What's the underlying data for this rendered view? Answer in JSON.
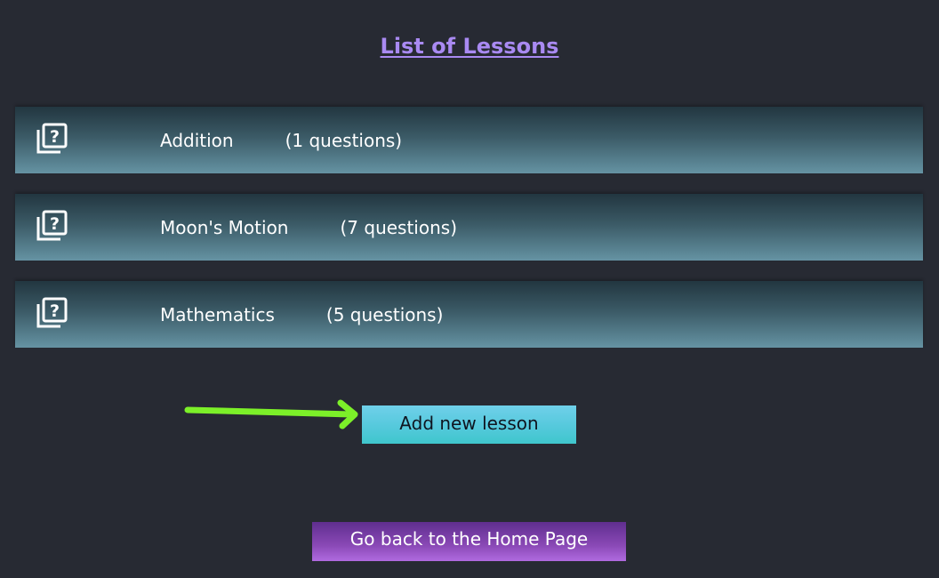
{
  "header": {
    "title": "List of Lessons"
  },
  "lessons": [
    {
      "name": "Addition",
      "count_text": "(1 questions)",
      "icon": "question-stack-icon"
    },
    {
      "name": "Moon's Motion",
      "count_text": "(7 questions)",
      "icon": "question-stack-icon"
    },
    {
      "name": "Mathematics",
      "count_text": "(5 questions)",
      "icon": "question-stack-icon"
    }
  ],
  "actions": {
    "add_lesson_label": "Add new lesson",
    "home_label": "Go back to the Home Page"
  },
  "annotation": {
    "arrow_icon": "green-arrow-icon",
    "arrow_color": "#7cf029"
  },
  "colors": {
    "background": "#272a33",
    "title": "#a98af2",
    "add_button": "#55c9dc",
    "home_button": "#8a49b6"
  }
}
